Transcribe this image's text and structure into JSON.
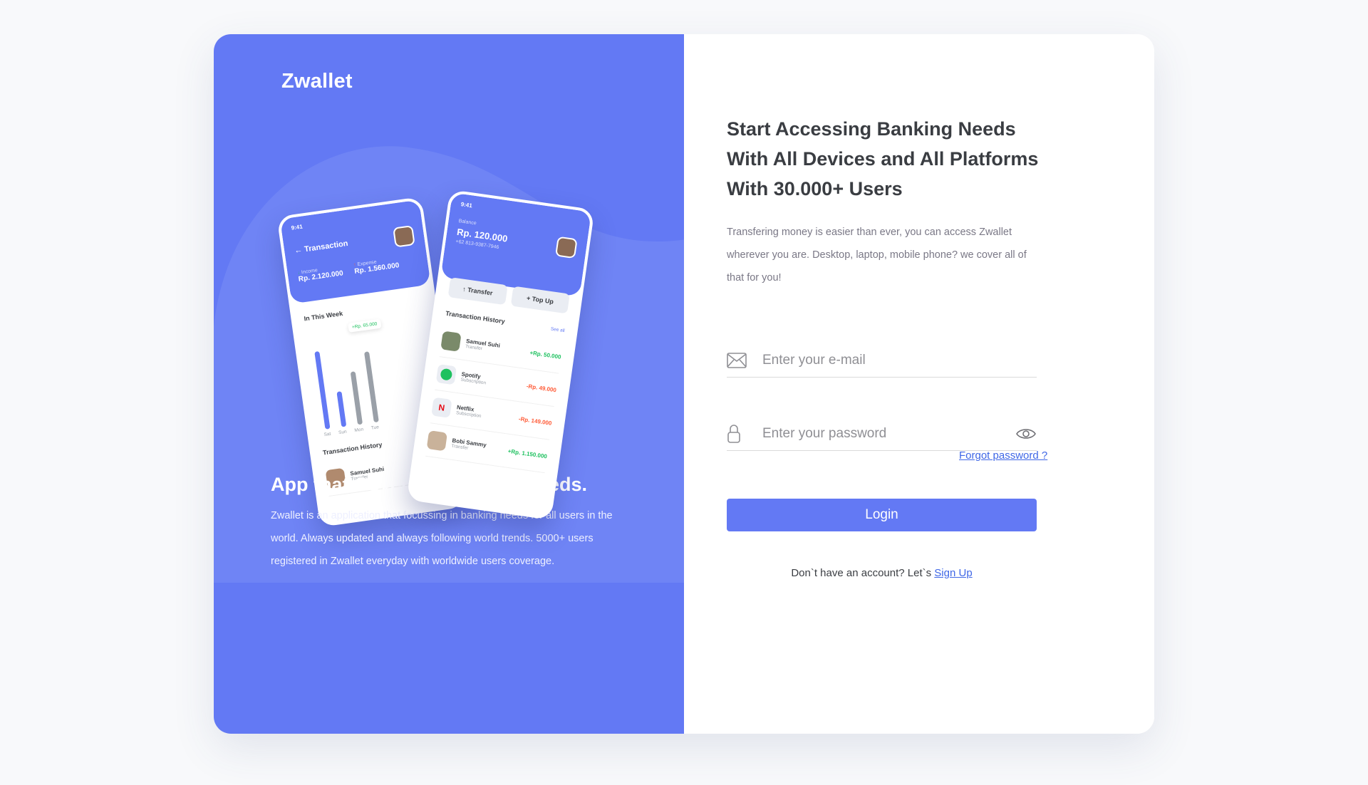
{
  "brand": {
    "name": "Zwallet"
  },
  "promo": {
    "title": "App that Covering Banking Needs.",
    "description": "Zwallet is an application that focussing in banking needs for all users in the world. Always updated and always following world trends. 5000+ users registered in Zwallet everyday with worldwide users coverage."
  },
  "mockup": {
    "back_phone": {
      "time": "9:41",
      "title": "Transaction",
      "income_label": "Income",
      "income_value": "Rp. 2.120.000",
      "expense_label": "Expense",
      "expense_value": "Rp. 1.560.000",
      "week_label": "In This Week",
      "bar_tooltip": "+Rp. 65.000",
      "days": [
        "Sat",
        "Sun",
        "Mon",
        "Tue"
      ],
      "history_label": "Transaction History",
      "history_first": "Samuel Suhi",
      "history_first_sub": "Transfer"
    },
    "front_phone": {
      "time": "9:41",
      "balance_label": "Balance",
      "balance_value": "Rp. 120.000",
      "phone_number": "+62 813-9387-7946",
      "transfer_label": "Transfer",
      "topup_label": "Top Up",
      "history_label": "Transaction History",
      "see_all": "See all",
      "transactions": [
        {
          "name": "Samuel Suhi",
          "type": "Transfer",
          "amount": "+Rp. 50.000"
        },
        {
          "name": "Spotify",
          "type": "Subscription",
          "amount": "-Rp. 49.000"
        },
        {
          "name": "Netflix",
          "type": "Subscription",
          "amount": "-Rp. 149.000"
        },
        {
          "name": "Bobi Sammy",
          "type": "Transfer",
          "amount": "+Rp. 1.150.000"
        }
      ]
    }
  },
  "login": {
    "headline": "Start Accessing Banking Needs With All Devices and All Platforms With 30.000+ Users",
    "description": "Transfering money is easier than ever, you can access Zwallet wherever you are. Desktop, laptop, mobile phone? we cover all of that for you!",
    "email_placeholder": "Enter your e-mail",
    "password_placeholder": "Enter your password",
    "forgot_password": "Forgot password ?",
    "login_button": "Login",
    "signup_prompt": "Don`t have an account? Let`s",
    "signup_link": "Sign Up"
  },
  "colors": {
    "primary": "#6379f4",
    "link": "#3f67e6",
    "positive": "#1ec15f",
    "negative": "#ff5b37"
  }
}
